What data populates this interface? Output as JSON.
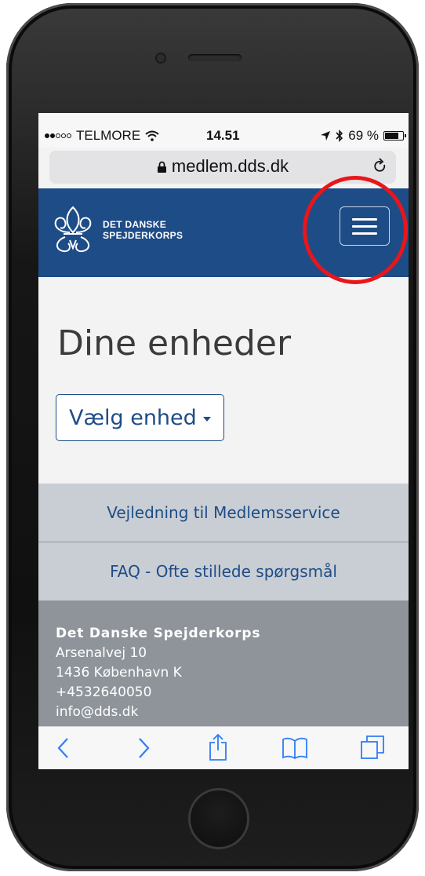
{
  "status_bar": {
    "carrier": "TELMORE",
    "time": "14.51",
    "battery": "69 %",
    "battery_level": 0.69,
    "signal_bars": 2
  },
  "browser": {
    "url": "medlem.dds.dk"
  },
  "header": {
    "logo_line1": "DET DANSKE",
    "logo_line2": "SPEJDERKORPS",
    "brand_color": "#1e4c86"
  },
  "main": {
    "title": "Dine enheder",
    "select_label": "Vælg enhed"
  },
  "links": [
    {
      "label": "Vejledning til Medlemsservice"
    },
    {
      "label": "FAQ - Ofte stillede spørgsmål"
    }
  ],
  "footer": {
    "org": "Det Danske Spejderkorps",
    "address": "Arsenalvej 10",
    "city": "1436 København K",
    "phone": "+4532640050",
    "email": "info@dds.dk"
  },
  "colors": {
    "annotation": "#e8161b",
    "link_bg": "#c9ced4",
    "footer_bg": "#8f949b",
    "ios_blue": "#2f7cf6"
  }
}
